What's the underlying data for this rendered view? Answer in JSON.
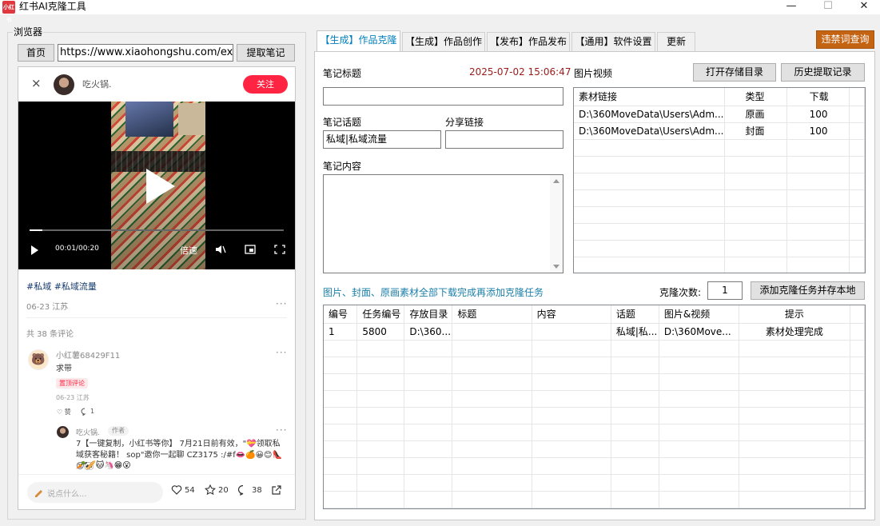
{
  "window": {
    "title": "红书AI克隆工具",
    "logo_text": "小红书",
    "minimize": "—",
    "maximize": "☐",
    "close": "✕"
  },
  "browser": {
    "group_label": "浏览器",
    "home_label": "首页",
    "url": "https://www.xiaohongshu.com/explor",
    "extract_label": "提取笔记",
    "page": {
      "close": "×",
      "author": "吃火锅.",
      "follow": "关注",
      "video": {
        "time": "00:01/00:20",
        "speed": "倍速",
        "progress": 0.05
      },
      "tags": "#私域 #私域流量",
      "date_location": "06-23 江苏",
      "more": "···",
      "comment_count": "共 38 条评论",
      "comment": {
        "avatar": "🐻",
        "name": "小红薯68429F11",
        "text": "求带",
        "pinned": "置顶评论",
        "date": "06-23 江苏",
        "like": "♡ 赞",
        "reply": "1"
      },
      "reply": {
        "name": "吃火锅.",
        "badge": "作者",
        "text": "7【一键复制，小红书等你】 7月21日前有效，\"💝领取私域获客秘籍！ sop\"邀你一起聊 CZ3175 :/#f👄🍊😀😊👠😊🐼",
        "emoji": "🥕🥖🐱🦄😁😮"
      },
      "bottom": {
        "placeholder": "说点什么...",
        "likes": "54",
        "stars": "20",
        "comments": "38"
      }
    }
  },
  "tabs": [
    {
      "label": "【生成】作品克隆",
      "active": true
    },
    {
      "label": "【生成】作品创作",
      "active": false
    },
    {
      "label": "【发布】作品发布",
      "active": false
    },
    {
      "label": "【通用】软件设置",
      "active": false
    },
    {
      "label": "更新",
      "active": false
    }
  ],
  "violation_button": "违禁词查询",
  "clone": {
    "title_label": "笔记标题",
    "timestamp": "2025-07-02 15:06:47",
    "title_value": "",
    "topic_label": "笔记话题",
    "topic_value": "私域|私域流量",
    "share_label": "分享链接",
    "share_value": "",
    "content_label": "笔记内容",
    "media_label": "图片视频",
    "open_dir_button": "打开存储目录",
    "history_button": "历史提取记录",
    "media_table": {
      "columns": [
        "素材链接",
        "类型",
        "下载"
      ],
      "rows": [
        [
          "D:\\360MoveData\\Users\\Adm...",
          "原画",
          "100"
        ],
        [
          "D:\\360MoveData\\Users\\Adm...",
          "封面",
          "100"
        ]
      ]
    },
    "hint": "图片、封面、原画素材全部下载完成再添加克隆任务",
    "clone_count_label": "克隆次数:",
    "clone_count": "1",
    "add_task_button": "添加克隆任务并存本地",
    "task_table": {
      "columns": [
        "编号",
        "任务编号",
        "存放目录",
        "标题",
        "内容",
        "话题",
        "图片&视频",
        "提示"
      ],
      "rows": [
        [
          "1",
          "5800",
          "D:\\360...",
          "",
          "",
          "私域|私...",
          "D:\\360Move...",
          "素材处理完成"
        ]
      ]
    }
  }
}
